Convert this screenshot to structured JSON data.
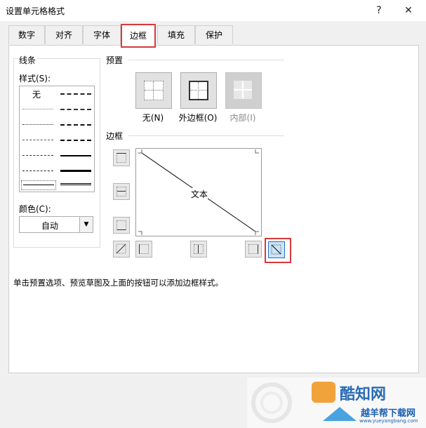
{
  "window": {
    "title": "设置单元格格式",
    "help_glyph": "?",
    "close_glyph": "✕"
  },
  "tabs": [
    {
      "label": "数字"
    },
    {
      "label": "对齐"
    },
    {
      "label": "字体"
    },
    {
      "label": "边框",
      "active": true
    },
    {
      "label": "填充"
    },
    {
      "label": "保护"
    }
  ],
  "line_section": {
    "title": "线条",
    "style_label": "样式(S):",
    "none_label": "无",
    "color_label": "颜色(C):",
    "color_value": "自动"
  },
  "presets": {
    "title": "预置",
    "items": [
      {
        "label": "无(N)",
        "enabled": true
      },
      {
        "label": "外边框(O)",
        "enabled": true
      },
      {
        "label": "内部(I)",
        "enabled": false
      }
    ]
  },
  "border_section": {
    "title": "边框",
    "preview_text": "文本",
    "diagonal_down_selected": true
  },
  "description": "单击预置选项、预览草图及上面的按钮可以添加边框样式。",
  "watermark": {
    "brand_text": "酷知网",
    "site_name": "越羊帮下载网",
    "site_url": "www.yueyangbang.com"
  },
  "colors": {
    "highlight": "#d9393c",
    "accent": "#1f6fcf"
  }
}
